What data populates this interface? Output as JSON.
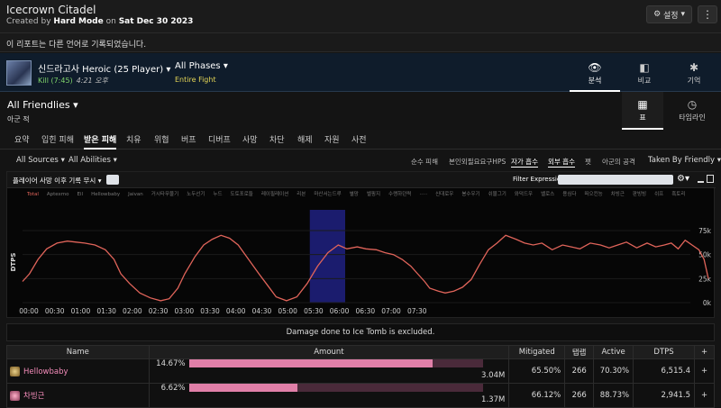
{
  "header": {
    "title": "Icecrown Citadel",
    "created_by": "Created by",
    "author": "Hard Mode",
    "on": "on",
    "date": "Sat Dec 30 2023",
    "settings_label": "설정",
    "more_label": "⋮"
  },
  "notice": "이 리포트는 다른 언어로 기록되었습니다.",
  "fight": {
    "boss": "신드라고사 Heroic (25 Player)",
    "kill": "Kill (7:45)",
    "time": "4:21 오후",
    "phase": "All Phases",
    "phase_sub": "Entire Fight"
  },
  "fight_tabs": [
    {
      "label": "분석",
      "icon": "eye-icon"
    },
    {
      "label": "비교",
      "icon": "compare-icon"
    },
    {
      "label": "기억",
      "icon": "puzzle-icon"
    }
  ],
  "friendlies": {
    "title": "All Friendlies",
    "sub": "아군 적"
  },
  "view_tabs": [
    {
      "label": "표",
      "icon": "table-icon"
    },
    {
      "label": "타임라인",
      "icon": "clock-icon"
    }
  ],
  "tabs": [
    "요약",
    "입힌 피해",
    "받은 피해",
    "치유",
    "위협",
    "버프",
    "디버프",
    "사망",
    "차단",
    "해제",
    "자원",
    "사전"
  ],
  "active_tab": "받은 피해",
  "filters": {
    "sources": "All Sources",
    "abilities": "All Abilities",
    "options": [
      "순수 피해",
      "본인외필요요구HPS",
      "자가 흡수",
      "외부 흡수",
      "펫",
      "아군의 공격"
    ],
    "taken_by": "Taken By Friendly"
  },
  "graph": {
    "dead_label": "플레이어 사망 이후 기록 무시",
    "filter_label": "Filter Expression:"
  },
  "legend": [
    "Total",
    "Aptexmo",
    "Eil",
    "Hellowbaby",
    "Jaivan",
    "거시타무물기",
    "노두선기",
    "누드",
    "도토포로들",
    "레이필레이션",
    "리븐",
    "마산서는드루",
    "별망",
    "벨핑지",
    "수랭하던력",
    "·····",
    "신대로우",
    "봉수우기",
    "쉬물그기",
    "와덕드우",
    "밸로스",
    "용심다",
    "떠으킨능",
    "차빙근",
    "판빙빙",
    "쉬프",
    "흑토리"
  ],
  "chart_data": {
    "type": "line",
    "title": "",
    "xlabel": "",
    "ylabel": "DTPS",
    "yticks": [
      "0k",
      "25k",
      "50k",
      "75k"
    ],
    "ylim": [
      0,
      85000
    ],
    "xticks": [
      "00:00",
      "00:30",
      "01:00",
      "01:30",
      "02:00",
      "02:30",
      "03:00",
      "03:30",
      "04:00",
      "04:30",
      "05:00",
      "05:30",
      "06:00",
      "06:30",
      "07:00",
      "07:30"
    ],
    "highlight": {
      "from": "05:33",
      "to": "06:14"
    },
    "series": [
      {
        "name": "Total",
        "color": "#e0645a",
        "x": [
          0,
          8,
          18,
          28,
          40,
          52,
          62,
          72,
          84,
          96,
          106,
          114,
          124,
          136,
          148,
          160,
          170,
          180,
          188,
          200,
          210,
          220,
          230,
          240,
          250,
          262,
          274,
          284,
          294,
          306,
          318,
          330,
          342,
          354,
          366,
          376,
          388,
          398,
          410,
          420,
          430,
          440,
          450,
          458,
          466,
          472,
          482,
          490,
          500,
          510,
          520,
          530,
          540,
          550,
          560,
          572,
          582,
          592,
          602,
          614,
          626,
          636,
          646,
          658,
          670,
          680,
          690,
          700,
          712,
          724,
          734,
          744,
          752,
          760,
          768,
          776,
          784,
          790,
          795
        ],
        "y": [
          22000,
          30000,
          45000,
          56000,
          62000,
          64000,
          63000,
          62000,
          60000,
          55000,
          45000,
          30000,
          20000,
          10000,
          5000,
          2000,
          4000,
          15000,
          30000,
          48000,
          60000,
          66000,
          70000,
          67000,
          60000,
          45000,
          30000,
          18000,
          6000,
          2000,
          6000,
          20000,
          38000,
          52000,
          60000,
          56000,
          58000,
          56000,
          55000,
          52000,
          50000,
          45000,
          38000,
          30000,
          22000,
          15000,
          12000,
          10000,
          12000,
          16000,
          24000,
          40000,
          55000,
          62000,
          70000,
          66000,
          62000,
          60000,
          62000,
          55000,
          60000,
          58000,
          56000,
          62000,
          60000,
          57000,
          60000,
          63000,
          57000,
          62000,
          58000,
          60000,
          62000,
          56000,
          65000,
          60000,
          55000,
          45000,
          25000
        ]
      }
    ]
  },
  "excluded": "Damage done to Ice Tomb is excluded.",
  "table": {
    "headers": [
      "Name",
      "Amount",
      "Mitigated",
      "탭랩",
      "Active",
      "DTPS",
      "+"
    ],
    "rows": [
      {
        "name": "Hellowbaby",
        "pct": "14.67%",
        "fill": 0.83,
        "amount": "3.04M",
        "mitigated": "65.50%",
        "taps": "266",
        "active": "70.30%",
        "dtps": "6,515.4",
        "plus": "+"
      },
      {
        "name": "차빙근",
        "pct": "6.62%",
        "fill": 0.37,
        "amount": "1.37M",
        "mitigated": "66.12%",
        "taps": "266",
        "active": "88.73%",
        "dtps": "2,941.5",
        "plus": "+"
      }
    ]
  }
}
